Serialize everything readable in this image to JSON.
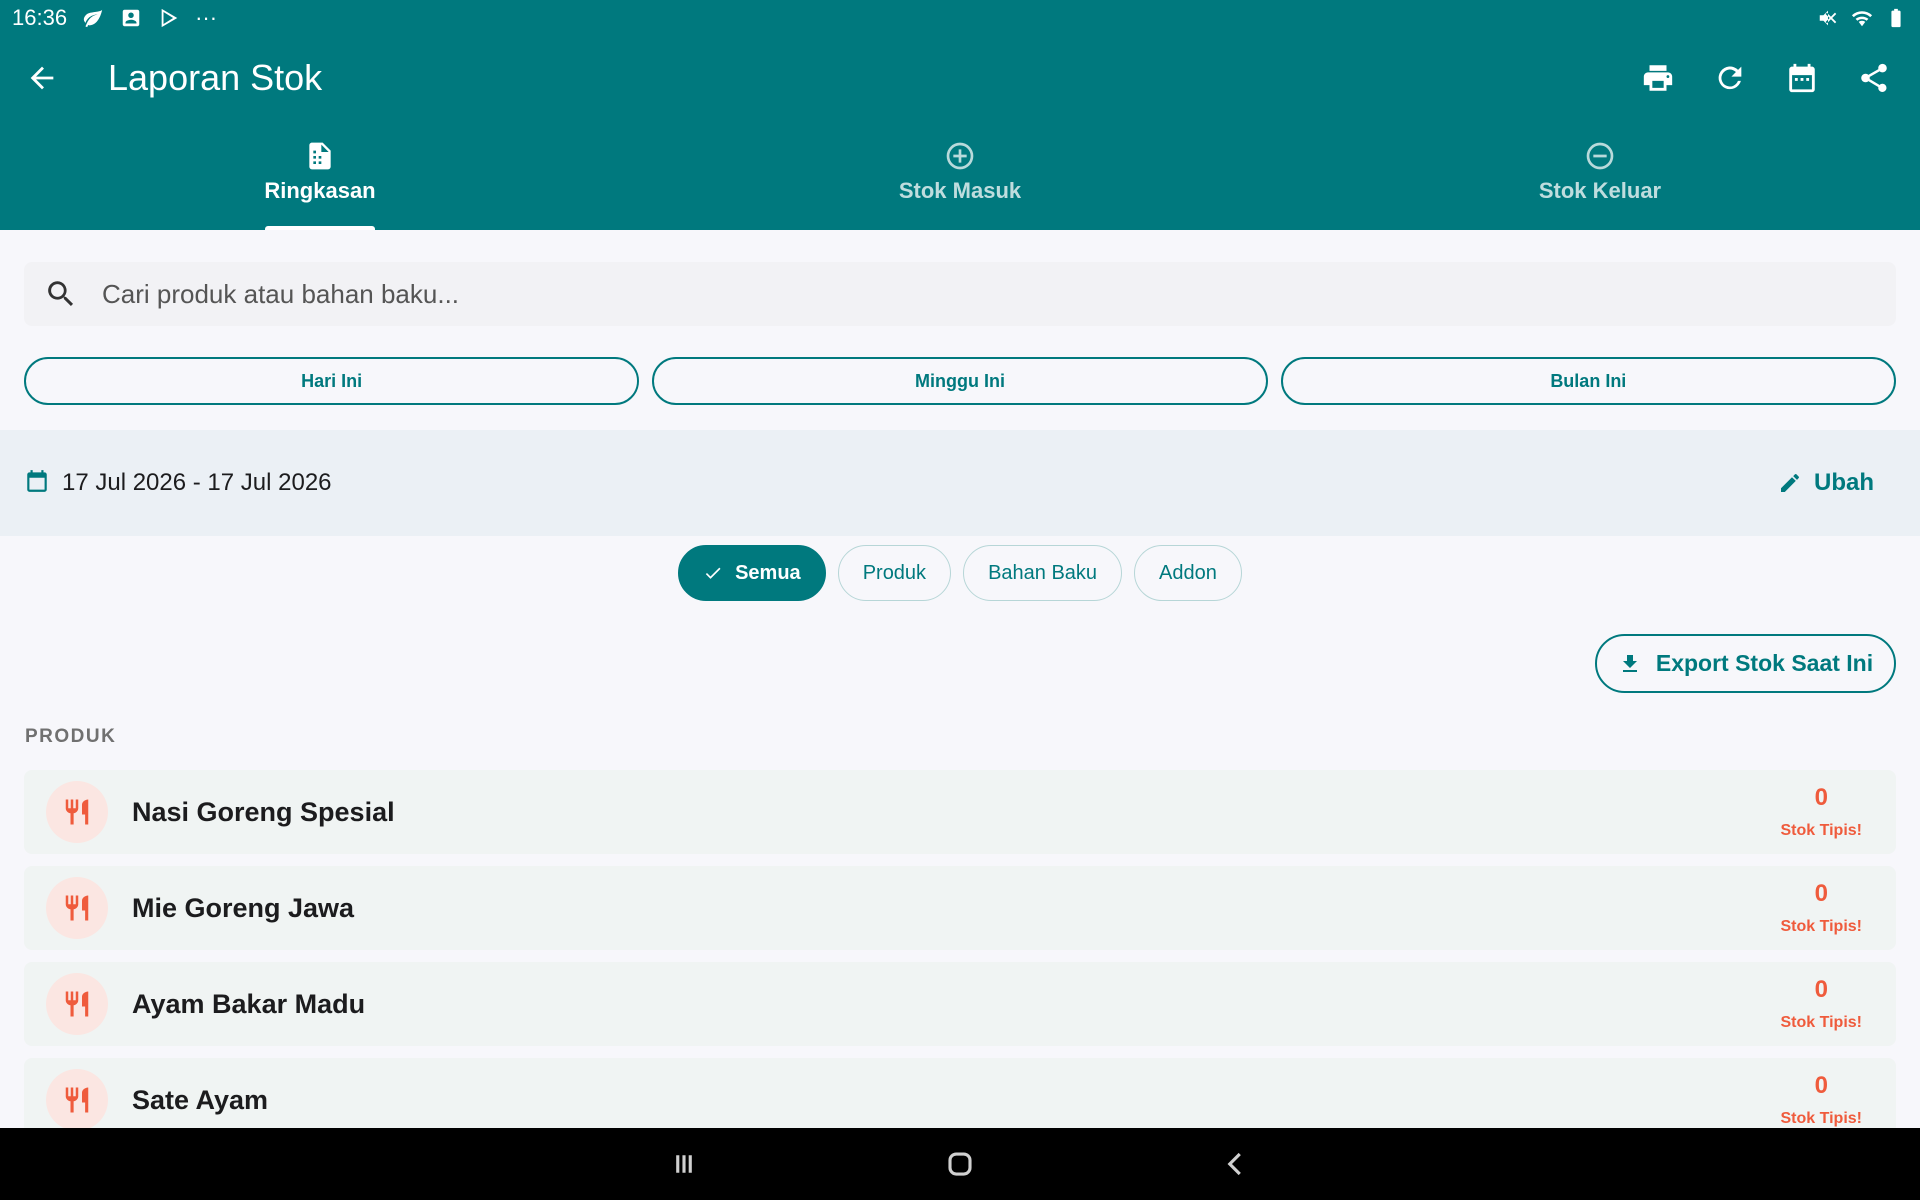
{
  "status_bar": {
    "time": "16:36",
    "overflow": "···"
  },
  "app_bar": {
    "title": "Laporan Stok",
    "actions": [
      "print-icon",
      "refresh-icon",
      "calendar-icon",
      "share-icon"
    ]
  },
  "tabs": [
    {
      "label": "Ringkasan",
      "icon": "document-icon",
      "active": true
    },
    {
      "label": "Stok Masuk",
      "icon": "plus-circle-icon",
      "active": false
    },
    {
      "label": "Stok Keluar",
      "icon": "minus-circle-icon",
      "active": false
    }
  ],
  "search": {
    "placeholder": "Cari produk atau bahan baku...",
    "value": ""
  },
  "periods": [
    "Hari Ini",
    "Minggu Ini",
    "Bulan Ini"
  ],
  "date_filter": {
    "range": "17 Jul 2026 - 17 Jul 2026",
    "edit_label": "Ubah"
  },
  "chips": [
    {
      "label": "Semua",
      "selected": true
    },
    {
      "label": "Produk",
      "selected": false
    },
    {
      "label": "Bahan Baku",
      "selected": false
    },
    {
      "label": "Addon",
      "selected": false
    }
  ],
  "export_label": "Export Stok Saat Ini",
  "section_label": "PRODUK",
  "products": [
    {
      "name": "Nasi Goreng Spesial",
      "qty": "0",
      "status": "Stok Tipis!"
    },
    {
      "name": "Mie Goreng Jawa",
      "qty": "0",
      "status": "Stok Tipis!"
    },
    {
      "name": "Ayam Bakar Madu",
      "qty": "0",
      "status": "Stok Tipis!"
    },
    {
      "name": "Sate Ayam",
      "qty": "0",
      "status": "Stok Tipis!"
    }
  ],
  "colors": {
    "primary": "#00797e",
    "warning": "#ef5b3c",
    "date_band": "#ebf0f5"
  }
}
